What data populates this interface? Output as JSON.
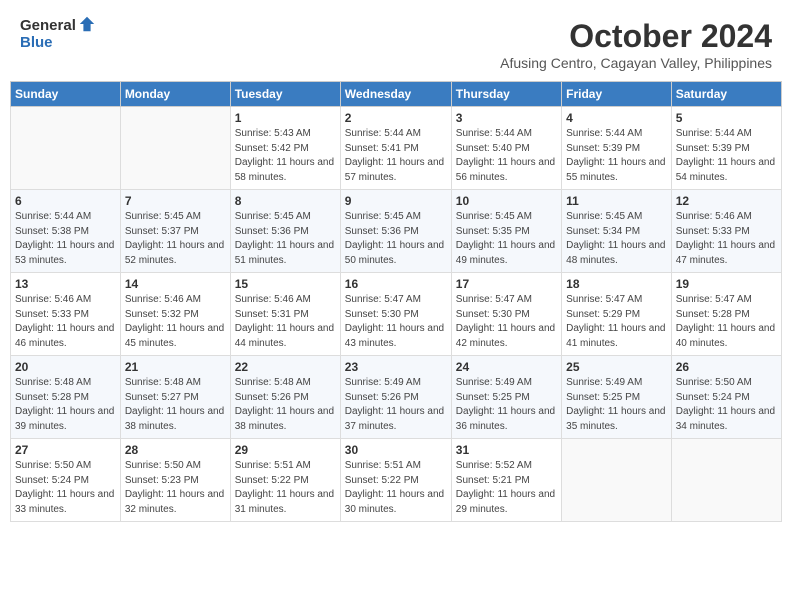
{
  "header": {
    "logo_general": "General",
    "logo_blue": "Blue",
    "title": "October 2024",
    "location": "Afusing Centro, Cagayan Valley, Philippines"
  },
  "days_of_week": [
    "Sunday",
    "Monday",
    "Tuesday",
    "Wednesday",
    "Thursday",
    "Friday",
    "Saturday"
  ],
  "weeks": [
    [
      {
        "day": "",
        "detail": ""
      },
      {
        "day": "",
        "detail": ""
      },
      {
        "day": "1",
        "detail": "Sunrise: 5:43 AM\nSunset: 5:42 PM\nDaylight: 11 hours and 58 minutes."
      },
      {
        "day": "2",
        "detail": "Sunrise: 5:44 AM\nSunset: 5:41 PM\nDaylight: 11 hours and 57 minutes."
      },
      {
        "day": "3",
        "detail": "Sunrise: 5:44 AM\nSunset: 5:40 PM\nDaylight: 11 hours and 56 minutes."
      },
      {
        "day": "4",
        "detail": "Sunrise: 5:44 AM\nSunset: 5:39 PM\nDaylight: 11 hours and 55 minutes."
      },
      {
        "day": "5",
        "detail": "Sunrise: 5:44 AM\nSunset: 5:39 PM\nDaylight: 11 hours and 54 minutes."
      }
    ],
    [
      {
        "day": "6",
        "detail": "Sunrise: 5:44 AM\nSunset: 5:38 PM\nDaylight: 11 hours and 53 minutes."
      },
      {
        "day": "7",
        "detail": "Sunrise: 5:45 AM\nSunset: 5:37 PM\nDaylight: 11 hours and 52 minutes."
      },
      {
        "day": "8",
        "detail": "Sunrise: 5:45 AM\nSunset: 5:36 PM\nDaylight: 11 hours and 51 minutes."
      },
      {
        "day": "9",
        "detail": "Sunrise: 5:45 AM\nSunset: 5:36 PM\nDaylight: 11 hours and 50 minutes."
      },
      {
        "day": "10",
        "detail": "Sunrise: 5:45 AM\nSunset: 5:35 PM\nDaylight: 11 hours and 49 minutes."
      },
      {
        "day": "11",
        "detail": "Sunrise: 5:45 AM\nSunset: 5:34 PM\nDaylight: 11 hours and 48 minutes."
      },
      {
        "day": "12",
        "detail": "Sunrise: 5:46 AM\nSunset: 5:33 PM\nDaylight: 11 hours and 47 minutes."
      }
    ],
    [
      {
        "day": "13",
        "detail": "Sunrise: 5:46 AM\nSunset: 5:33 PM\nDaylight: 11 hours and 46 minutes."
      },
      {
        "day": "14",
        "detail": "Sunrise: 5:46 AM\nSunset: 5:32 PM\nDaylight: 11 hours and 45 minutes."
      },
      {
        "day": "15",
        "detail": "Sunrise: 5:46 AM\nSunset: 5:31 PM\nDaylight: 11 hours and 44 minutes."
      },
      {
        "day": "16",
        "detail": "Sunrise: 5:47 AM\nSunset: 5:30 PM\nDaylight: 11 hours and 43 minutes."
      },
      {
        "day": "17",
        "detail": "Sunrise: 5:47 AM\nSunset: 5:30 PM\nDaylight: 11 hours and 42 minutes."
      },
      {
        "day": "18",
        "detail": "Sunrise: 5:47 AM\nSunset: 5:29 PM\nDaylight: 11 hours and 41 minutes."
      },
      {
        "day": "19",
        "detail": "Sunrise: 5:47 AM\nSunset: 5:28 PM\nDaylight: 11 hours and 40 minutes."
      }
    ],
    [
      {
        "day": "20",
        "detail": "Sunrise: 5:48 AM\nSunset: 5:28 PM\nDaylight: 11 hours and 39 minutes."
      },
      {
        "day": "21",
        "detail": "Sunrise: 5:48 AM\nSunset: 5:27 PM\nDaylight: 11 hours and 38 minutes."
      },
      {
        "day": "22",
        "detail": "Sunrise: 5:48 AM\nSunset: 5:26 PM\nDaylight: 11 hours and 38 minutes."
      },
      {
        "day": "23",
        "detail": "Sunrise: 5:49 AM\nSunset: 5:26 PM\nDaylight: 11 hours and 37 minutes."
      },
      {
        "day": "24",
        "detail": "Sunrise: 5:49 AM\nSunset: 5:25 PM\nDaylight: 11 hours and 36 minutes."
      },
      {
        "day": "25",
        "detail": "Sunrise: 5:49 AM\nSunset: 5:25 PM\nDaylight: 11 hours and 35 minutes."
      },
      {
        "day": "26",
        "detail": "Sunrise: 5:50 AM\nSunset: 5:24 PM\nDaylight: 11 hours and 34 minutes."
      }
    ],
    [
      {
        "day": "27",
        "detail": "Sunrise: 5:50 AM\nSunset: 5:24 PM\nDaylight: 11 hours and 33 minutes."
      },
      {
        "day": "28",
        "detail": "Sunrise: 5:50 AM\nSunset: 5:23 PM\nDaylight: 11 hours and 32 minutes."
      },
      {
        "day": "29",
        "detail": "Sunrise: 5:51 AM\nSunset: 5:22 PM\nDaylight: 11 hours and 31 minutes."
      },
      {
        "day": "30",
        "detail": "Sunrise: 5:51 AM\nSunset: 5:22 PM\nDaylight: 11 hours and 30 minutes."
      },
      {
        "day": "31",
        "detail": "Sunrise: 5:52 AM\nSunset: 5:21 PM\nDaylight: 11 hours and 29 minutes."
      },
      {
        "day": "",
        "detail": ""
      },
      {
        "day": "",
        "detail": ""
      }
    ]
  ]
}
